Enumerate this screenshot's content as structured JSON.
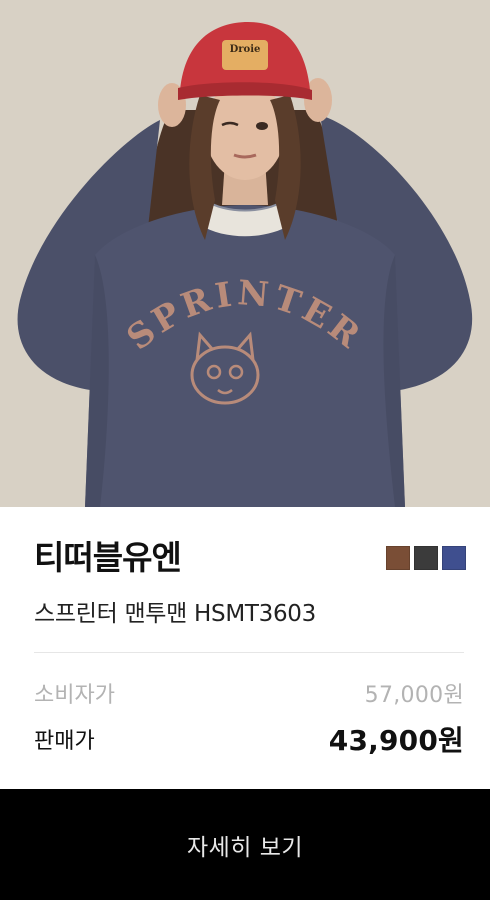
{
  "product": {
    "brand": "티떠블유엔",
    "name": "스프린터 맨투맨 HSMT3603",
    "image_alt": "SPRINTER sweatshirt model photo",
    "graphic_text": "SPRINTER",
    "cap_text": "Droie"
  },
  "colors": [
    "#7a4e36",
    "#3b3b3b",
    "#3f4f8f"
  ],
  "pricing": {
    "msrp_label": "소비자가",
    "msrp_value": "57,000원",
    "sale_label": "판매가",
    "sale_value": "43,900원"
  },
  "cta": {
    "label": "자세히 보기"
  }
}
